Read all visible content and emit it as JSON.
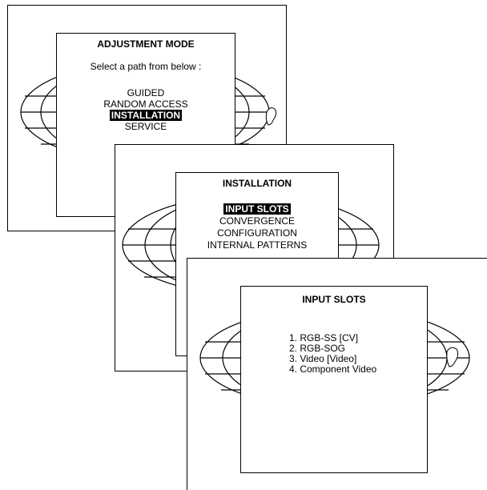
{
  "screens": {
    "adjustment": {
      "title": "ADJUSTMENT MODE",
      "prompt": "Select a path from below :",
      "items": [
        "GUIDED",
        "RANDOM ACCESS",
        "INSTALLATION",
        "SERVICE"
      ],
      "selected": "INSTALLATION"
    },
    "installation": {
      "title": "INSTALLATION",
      "items": [
        "INPUT SLOTS",
        "CONVERGENCE",
        "CONFIGURATION",
        "INTERNAL PATTERNS"
      ],
      "selected": "INPUT SLOTS"
    },
    "input_slots": {
      "title": "INPUT SLOTS",
      "items": [
        "1. RGB-SS [CV]",
        "2. RGB-SOG",
        "3. Video [Video]",
        "4. Component Video"
      ]
    }
  },
  "icons": [
    "globe-icon",
    "hand-icon"
  ]
}
